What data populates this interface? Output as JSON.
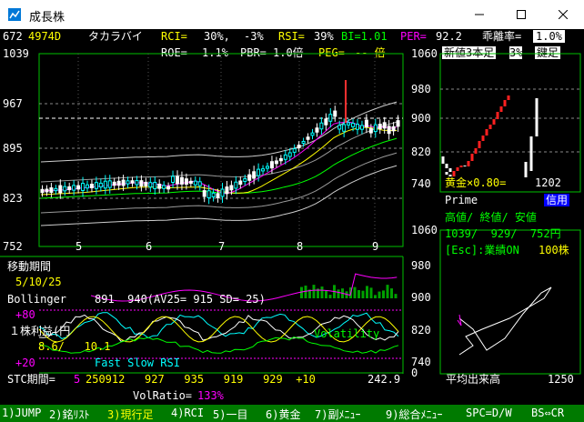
{
  "window": {
    "title": "成長株",
    "min_icon": "minimize-icon",
    "max_icon": "maximize-icon",
    "close_icon": "close-icon"
  },
  "header": {
    "code": "672",
    "ticker": "4974D",
    "name": "タカラバイ",
    "rci_label": "RCI=",
    "rci_value": "30%,",
    "rci_change": "-3%",
    "rsi_label": "RSI=",
    "rsi_value": "39%",
    "bi_label": "BI=1.01",
    "per_label": "PER=",
    "per_value": "92.2",
    "kairi_label": "乖離率=",
    "kairi_value": "1.0%",
    "roe_label": "ROE=",
    "roe_value": "1.1%",
    "pbr_label": "PBR=",
    "pbr_value": "1.0倍",
    "peg_label": "PEG=",
    "peg_value": "-- 倍",
    "new3_label": "新値3本足",
    "new3_value": "3%",
    "new3_suffix": "鍵足"
  },
  "main_chart": {
    "y_ticks": [
      "1039",
      "967",
      "895",
      "823",
      "752"
    ],
    "x_ticks": [
      "5",
      "6",
      "7",
      "8",
      "9"
    ],
    "price_min": 752,
    "price_max": 1039
  },
  "right_top": {
    "y_ticks": [
      "1060",
      "980",
      "900",
      "820",
      "740"
    ],
    "gold_label": "黄金×0.80=",
    "gold_value": "1202"
  },
  "info": {
    "market": "Prime",
    "credit": "信用",
    "hl_label": "高値/ 終値/ 安値",
    "hl_values": "1039/  929/  752円",
    "esc_label": "[Esc]:業績ON",
    "esc_value": "100株"
  },
  "right_mid": {
    "y_ticks": [
      "1060",
      "980",
      "900",
      "820",
      "740",
      "0"
    ]
  },
  "indicators": {
    "period_label": "移動期間",
    "period_values": "5/10/25",
    "bollinger_label": "Bollinger",
    "bollinger_values": "891  940(AV25= 915 SD= 25)",
    "plus80": "+80",
    "eps_label": "１株利益(円",
    "eps_values": "8.6/   10.1",
    "volatility": "Volatility",
    "plus20": "+20",
    "fsr_label": "Fast Slow RSI",
    "stc_label": "STC期間=",
    "stc_period": "5",
    "stc_values": "250912   927   935   919   929  +10",
    "stc_last": "242.9",
    "volratio_label": "VolRatio=",
    "volratio_value": "133%",
    "avgvol_label": "平均出来高",
    "avgvol_value": "1250"
  },
  "footer": [
    {
      "label": "1)JUMP"
    },
    {
      "label": "2)銘ﾘｽﾄ"
    },
    {
      "label": "3)現行足"
    },
    {
      "label": "4)RCI"
    },
    {
      "label": "5)一目"
    },
    {
      "label": "6)黄金"
    },
    {
      "label": "7)副ﾒﾆｭｰ"
    },
    {
      "label": "9)総合ﾒﾆｭｰ"
    },
    {
      "label": "SPC=D/W"
    },
    {
      "label": "BS⇔CR"
    }
  ],
  "colors": {
    "up": "#ffffff",
    "down": "#00ffff",
    "ma5": "#ff00ff",
    "ma10": "#ffff00",
    "ma25": "#00ff00",
    "boll": "#c0c0c0"
  }
}
